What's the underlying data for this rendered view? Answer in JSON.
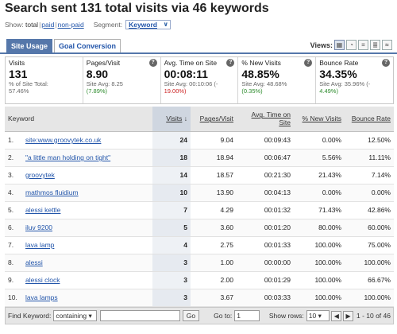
{
  "title": "Search sent 131 total visits via 46 keywords",
  "show": {
    "label": "Show:",
    "options": [
      "total",
      "paid",
      "non-paid"
    ],
    "segment_label": "Segment:",
    "segment_value": "Keyword"
  },
  "tabs": [
    "Site Usage",
    "Goal Conversion"
  ],
  "views_label": "Views:",
  "stats": [
    {
      "label": "Visits",
      "value": "131",
      "sub1": "% of Site Total:",
      "sub2": "57.46%",
      "sub2_class": ""
    },
    {
      "label": "Pages/Visit",
      "value": "8.90",
      "sub1": "Site Avg: 8.25",
      "sub2": "(7.89%)",
      "sub2_class": "pos"
    },
    {
      "label": "Avg. Time on Site",
      "value": "00:08:11",
      "sub1": "Site Avg: 00:10:06 (-",
      "sub2": "19.00%)",
      "sub2_class": "neg"
    },
    {
      "label": "% New Visits",
      "value": "48.85%",
      "sub1": "Site Avg: 48.68%",
      "sub2": "(0.35%)",
      "sub2_class": "pos"
    },
    {
      "label": "Bounce Rate",
      "value": "34.35%",
      "sub1": "Site Avg: 35.96% (-",
      "sub2": "4.49%)",
      "sub2_class": "pos"
    }
  ],
  "columns": {
    "keyword": "Keyword",
    "visits": "Visits",
    "pages": "Pages/Visit",
    "time": "Avg. Time on Site",
    "newv": "% New Visits",
    "bounce": "Bounce Rate"
  },
  "rows": [
    {
      "idx": "1.",
      "keyword": "site:www.groovytek.co.uk",
      "visits": "24",
      "pages": "9.04",
      "time": "00:09:43",
      "newv": "0.00%",
      "bounce": "12.50%"
    },
    {
      "idx": "2.",
      "keyword": "\"a little man holding on tight\"",
      "visits": "18",
      "pages": "18.94",
      "time": "00:06:47",
      "newv": "5.56%",
      "bounce": "11.11%"
    },
    {
      "idx": "3.",
      "keyword": "groovytek",
      "visits": "14",
      "pages": "18.57",
      "time": "00:21:30",
      "newv": "21.43%",
      "bounce": "7.14%"
    },
    {
      "idx": "4.",
      "keyword": "mathmos fluidium",
      "visits": "10",
      "pages": "13.90",
      "time": "00:04:13",
      "newv": "0.00%",
      "bounce": "0.00%"
    },
    {
      "idx": "5.",
      "keyword": "alessi kettle",
      "visits": "7",
      "pages": "4.29",
      "time": "00:01:32",
      "newv": "71.43%",
      "bounce": "42.86%"
    },
    {
      "idx": "6.",
      "keyword": "iluv 9200",
      "visits": "5",
      "pages": "3.60",
      "time": "00:01:20",
      "newv": "80.00%",
      "bounce": "60.00%"
    },
    {
      "idx": "7.",
      "keyword": "lava lamp",
      "visits": "4",
      "pages": "2.75",
      "time": "00:01:33",
      "newv": "100.00%",
      "bounce": "75.00%"
    },
    {
      "idx": "8.",
      "keyword": "alessi",
      "visits": "3",
      "pages": "1.00",
      "time": "00:00:00",
      "newv": "100.00%",
      "bounce": "100.00%"
    },
    {
      "idx": "9.",
      "keyword": "alessi clock",
      "visits": "3",
      "pages": "2.00",
      "time": "00:01:29",
      "newv": "100.00%",
      "bounce": "66.67%"
    },
    {
      "idx": "10.",
      "keyword": "lava lamps",
      "visits": "3",
      "pages": "3.67",
      "time": "00:03:33",
      "newv": "100.00%",
      "bounce": "100.00%"
    }
  ],
  "footer": {
    "find_label": "Find Keyword:",
    "match_value": "containing",
    "go_label": "Go",
    "goto_label": "Go to:",
    "goto_value": "1",
    "showrows_label": "Show rows:",
    "showrows_value": "10",
    "range": "1 - 10 of 46"
  }
}
